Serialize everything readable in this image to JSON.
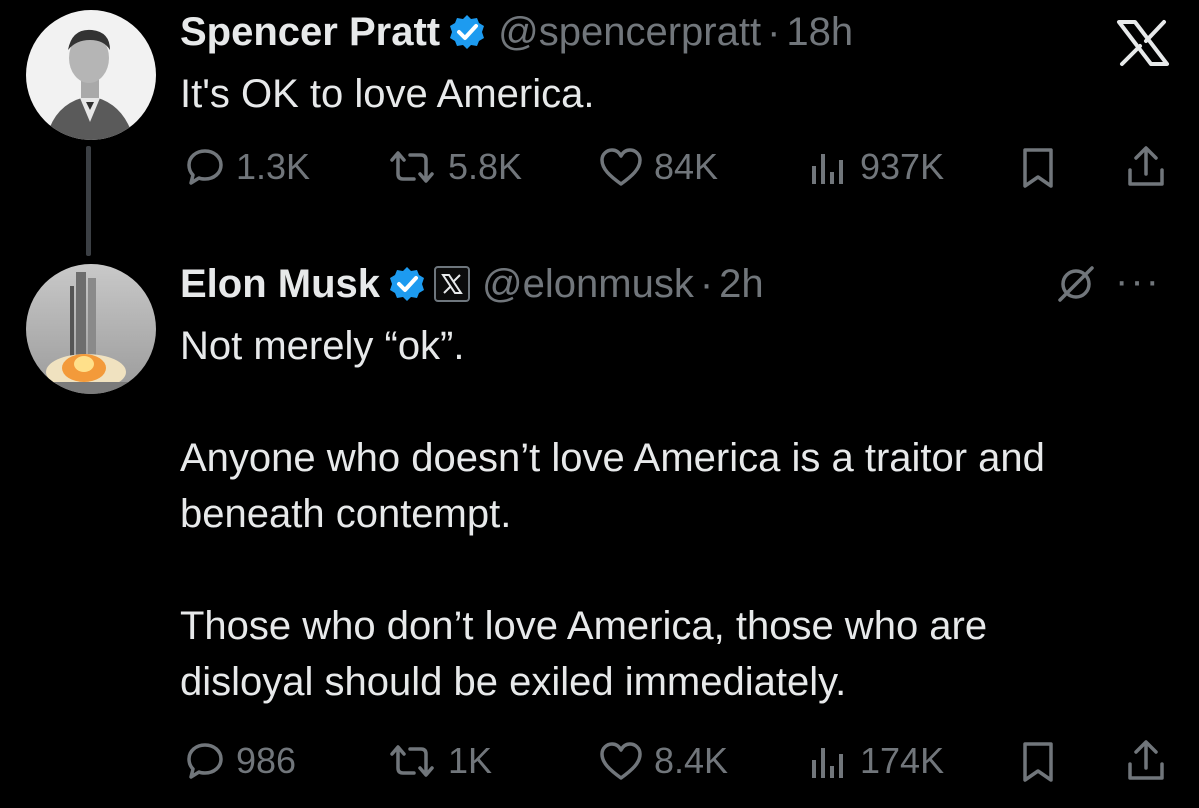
{
  "tweet1": {
    "name": "Spencer Pratt",
    "handle": "@spencerpratt",
    "separator": "·",
    "time": "18h",
    "text": "It's OK to love America.",
    "replies": "1.3K",
    "reposts": "5.8K",
    "likes": "84K",
    "views": "937K"
  },
  "tweet2": {
    "name": "Elon Musk",
    "handle": "@elonmusk",
    "separator": "·",
    "time": "2h",
    "paragraphs": [
      "Not merely “ok”.",
      "Anyone who doesn’t love America is a traitor and beneath contempt.",
      "Those who don’t love America, those who are disloyal should be exiled immediately."
    ],
    "replies": "986",
    "reposts": "1K",
    "likes": "8.4K",
    "views": "174K",
    "more_label": "···"
  },
  "colors": {
    "background": "#000000",
    "text": "#e7e9ea",
    "muted": "#71767b",
    "verified": "#1d9bf0"
  },
  "icons": [
    "x-logo-icon",
    "verified-badge-icon",
    "reply-icon",
    "repost-icon",
    "like-icon",
    "views-icon",
    "bookmark-icon",
    "share-icon",
    "grok-icon",
    "more-icon",
    "x-affiliate-icon"
  ]
}
